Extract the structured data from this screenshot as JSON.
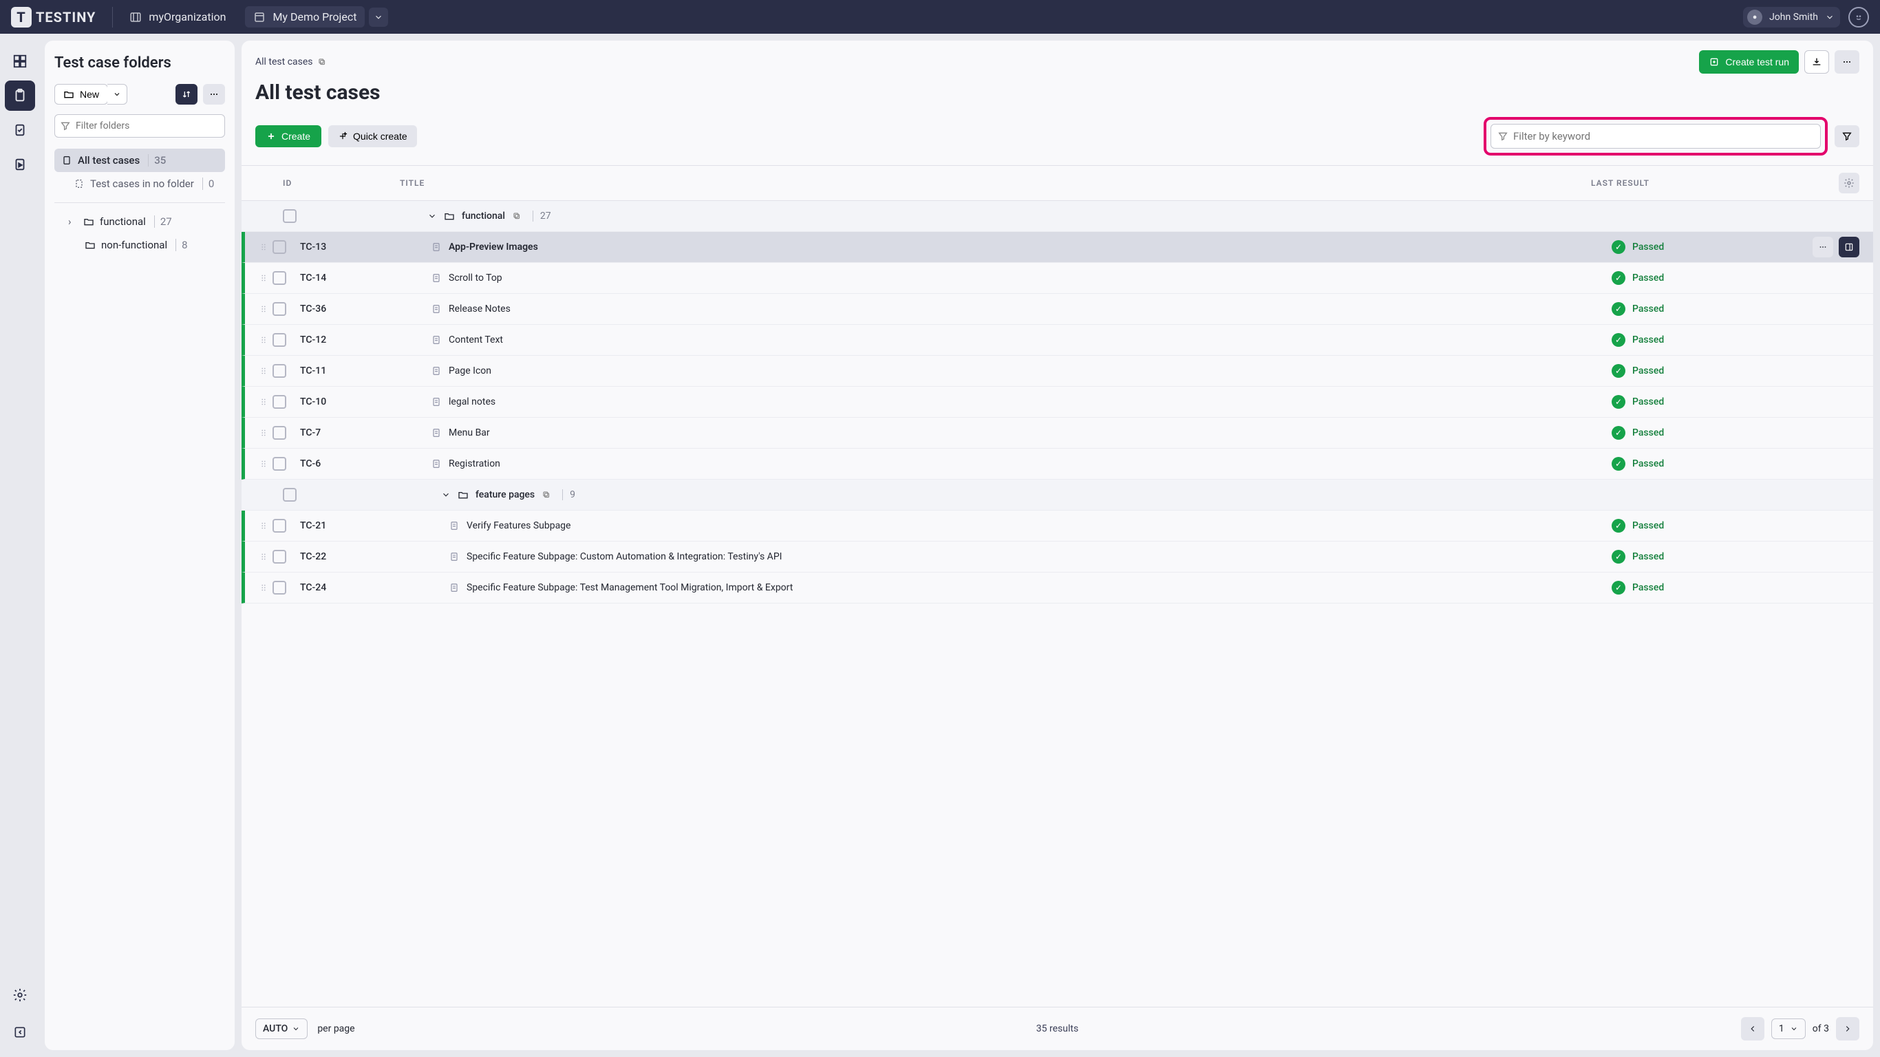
{
  "header": {
    "logo_text": "TESTINY",
    "org_name": "myOrganization",
    "project_name": "My Demo Project",
    "user_name": "John Smith"
  },
  "sidebar": {
    "title": "Test case folders",
    "new_label": "New",
    "filter_placeholder": "Filter folders",
    "all_label": "All test cases",
    "all_count": "35",
    "nofolder_label": "Test cases in no folder",
    "nofolder_count": "0",
    "folders": [
      {
        "name": "functional",
        "count": "27"
      },
      {
        "name": "non-functional",
        "count": "8"
      }
    ]
  },
  "crumb": {
    "root": "All test cases"
  },
  "actions": {
    "create_run": "Create test run",
    "create": "Create",
    "quick_create": "Quick create"
  },
  "page_title": "All test cases",
  "search_placeholder": "Filter by keyword",
  "columns": {
    "id": "ID",
    "title": "TITLE",
    "result": "LAST RESULT"
  },
  "groups": [
    {
      "name": "functional",
      "count": "27"
    },
    {
      "name": "feature pages",
      "count": "9"
    }
  ],
  "rows": [
    {
      "id": "TC-13",
      "title": "App-Preview Images",
      "result": "Passed",
      "selected": true
    },
    {
      "id": "TC-14",
      "title": "Scroll to Top",
      "result": "Passed"
    },
    {
      "id": "TC-36",
      "title": "Release Notes",
      "result": "Passed"
    },
    {
      "id": "TC-12",
      "title": "Content Text",
      "result": "Passed"
    },
    {
      "id": "TC-11",
      "title": "Page Icon",
      "result": "Passed"
    },
    {
      "id": "TC-10",
      "title": "legal notes",
      "result": "Passed"
    },
    {
      "id": "TC-7",
      "title": "Menu Bar",
      "result": "Passed"
    },
    {
      "id": "TC-6",
      "title": "Registration",
      "result": "Passed"
    },
    {
      "id": "TC-21",
      "title": "Verify Features Subpage",
      "result": "Passed",
      "indent": true
    },
    {
      "id": "TC-22",
      "title": "Specific Feature Subpage: Custom Automation & Integration: Testiny's API",
      "result": "Passed",
      "indent": true
    },
    {
      "id": "TC-24",
      "title": "Specific Feature Subpage: Test Management Tool Migration, Import & Export",
      "result": "Passed",
      "indent": true
    }
  ],
  "footer": {
    "auto": "AUTO",
    "per_page": "per page",
    "results": "35 results",
    "page": "1",
    "of": "of 3"
  }
}
